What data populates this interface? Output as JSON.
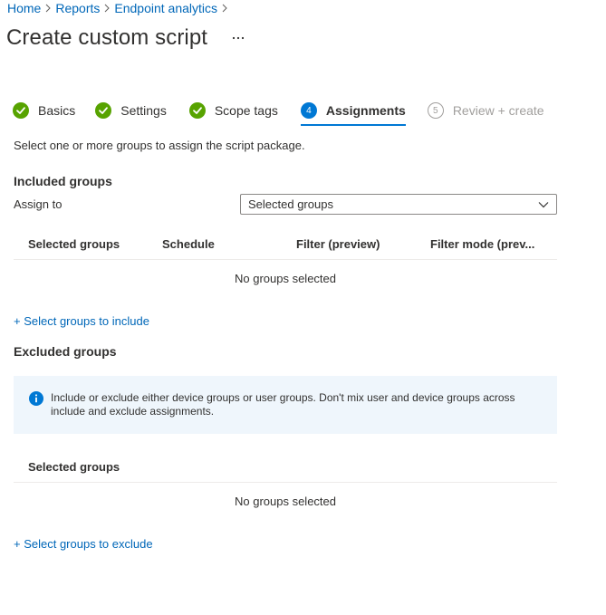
{
  "breadcrumb": {
    "items": [
      "Home",
      "Reports",
      "Endpoint analytics"
    ]
  },
  "page": {
    "title": "Create custom script",
    "more_label": "..."
  },
  "wizard": {
    "steps": [
      {
        "label": "Basics",
        "state": "complete"
      },
      {
        "label": "Settings",
        "state": "complete"
      },
      {
        "label": "Scope tags",
        "state": "complete"
      },
      {
        "label": "Assignments",
        "state": "current",
        "number": "4"
      },
      {
        "label": "Review + create",
        "state": "disabled",
        "number": "5"
      }
    ]
  },
  "assignments": {
    "description": "Select one or more groups to assign the script package.",
    "included": {
      "heading": "Included groups",
      "assign_to_label": "Assign to",
      "assign_to_value": "Selected groups",
      "columns": [
        "Selected groups",
        "Schedule",
        "Filter (preview)",
        "Filter mode (prev..."
      ],
      "empty_text": "No groups selected",
      "add_link": "+ Select groups to include"
    },
    "excluded": {
      "heading": "Excluded groups",
      "info_text": "Include or exclude either device groups or user groups. Don't mix user and device groups across include and exclude assignments.",
      "columns": [
        "Selected groups"
      ],
      "empty_text": "No groups selected",
      "add_link": "+ Select groups to exclude"
    }
  },
  "colors": {
    "accent": "#0078d4",
    "link": "#0067b8",
    "success": "#57a300",
    "info_bg": "#eff6fc"
  }
}
